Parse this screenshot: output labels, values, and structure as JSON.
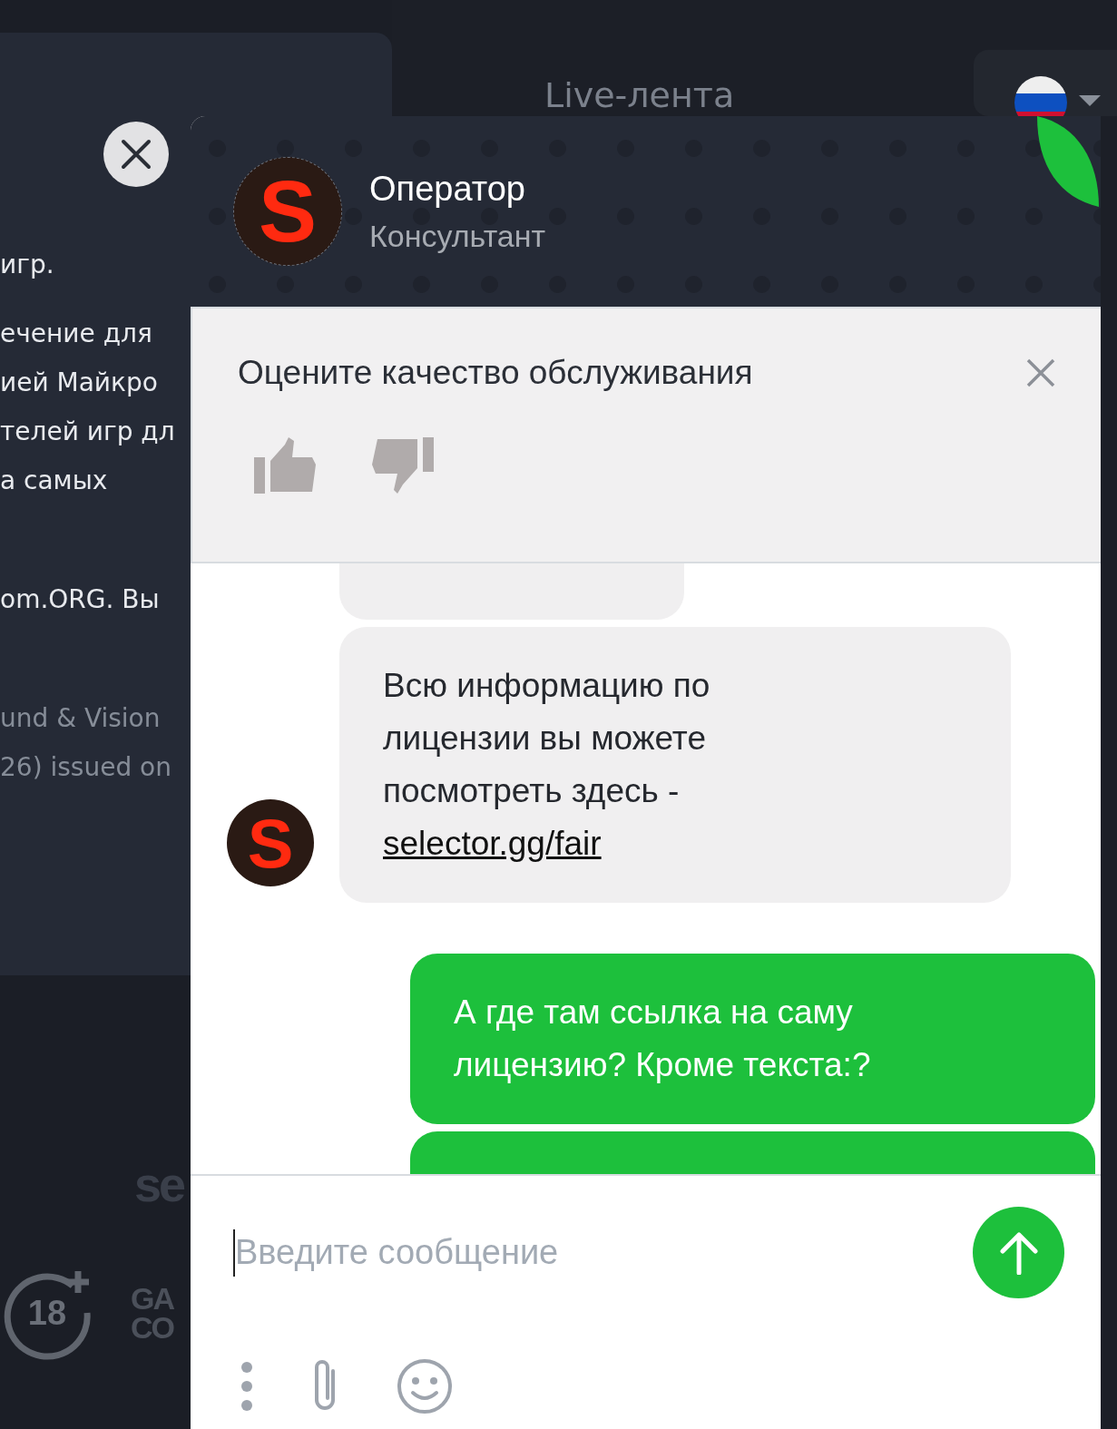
{
  "background": {
    "feed_tab": "Live-лента",
    "paragraphs": [
      {
        "kind": "body",
        "lines": [
          "игр."
        ]
      },
      {
        "kind": "body",
        "lines": [
          "ечение для",
          "ией Майкро",
          "телей игр дл",
          "а самых"
        ]
      },
      {
        "kind": "body",
        "lines": [
          "om.ORG. Вы"
        ]
      },
      {
        "kind": "muted",
        "lines": [
          "und & Vision",
          "26) issued on"
        ]
      }
    ],
    "logo_text": "se",
    "age_label": "18",
    "footer_logo_lines": [
      "GA",
      "CO"
    ]
  },
  "chat": {
    "operator": {
      "avatar_letter": "S",
      "name": "Оператор",
      "role": "Консультант"
    },
    "rating": {
      "title": "Оцените качество обслуживания"
    },
    "messages": [
      {
        "kind": "operator_cut"
      },
      {
        "kind": "operator_bubble",
        "text": "Всю информацию по лицензии вы можете посмотреть здесь -",
        "link": "selector.gg/fair",
        "avatar_letter": "S"
      },
      {
        "kind": "user_bubble",
        "text": "А где там ссылка на саму лицензию? Кроме текста:?"
      },
      {
        "kind": "user_cut"
      }
    ],
    "composer": {
      "placeholder": "Введите сообщение"
    }
  }
}
